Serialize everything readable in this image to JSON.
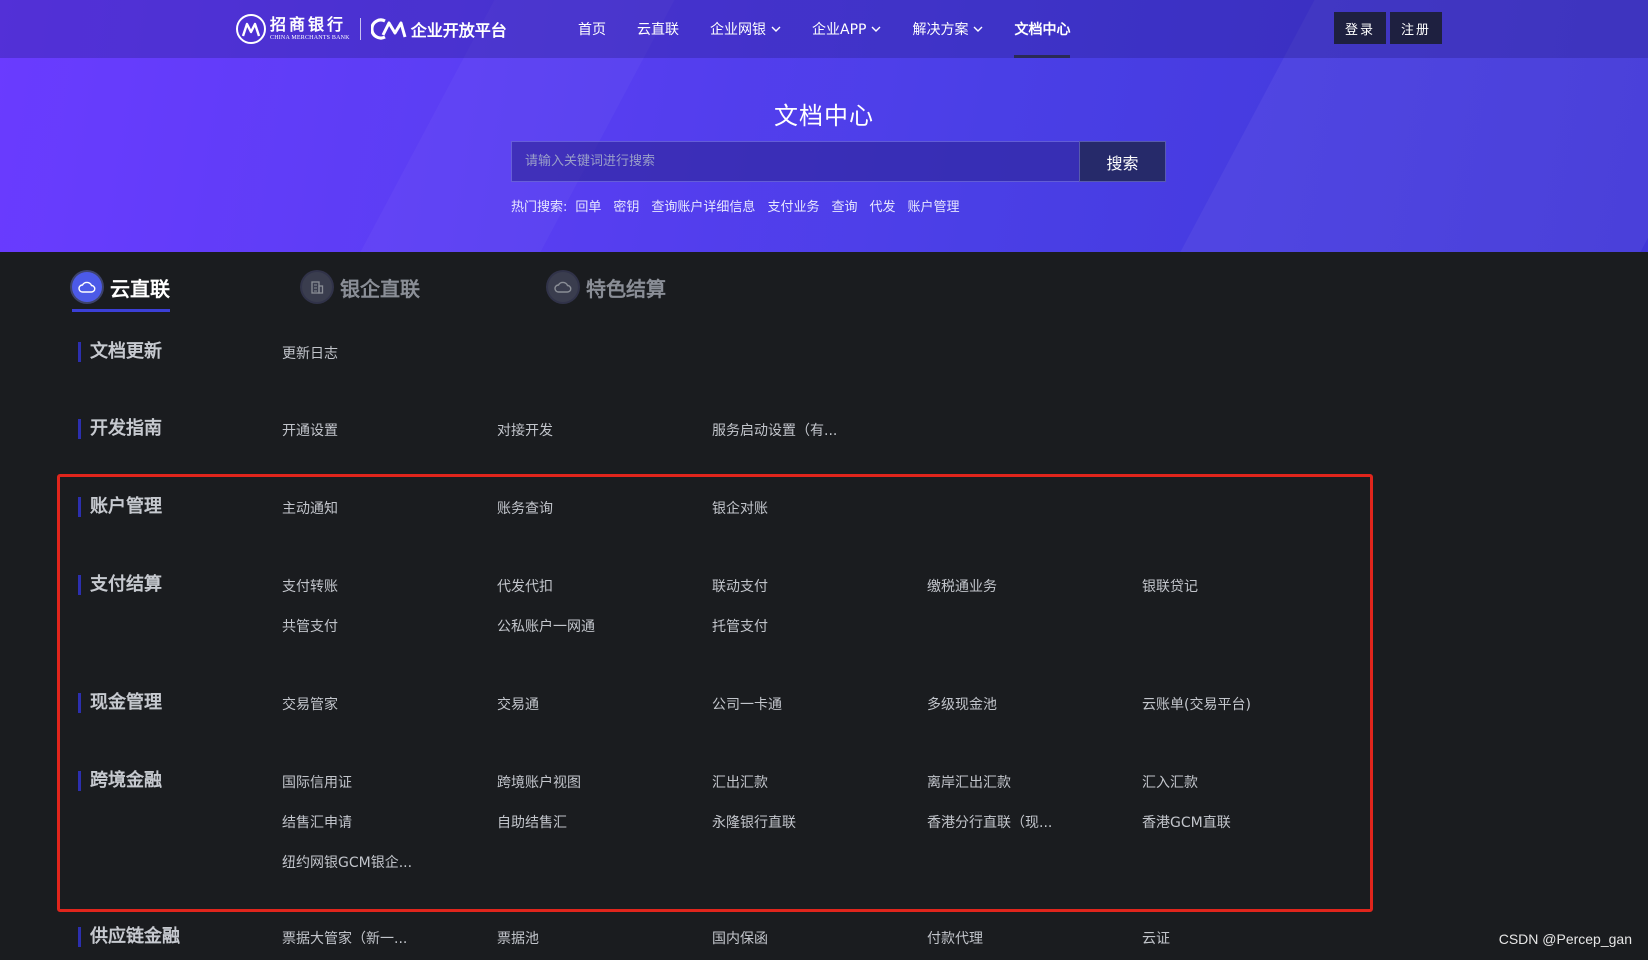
{
  "header": {
    "bank_name": "招商银行",
    "bank_name_en": "CHINA MERCHANTS BANK",
    "platform_name": "企业开放平台",
    "nav": [
      {
        "label": "首页",
        "dropdown": false
      },
      {
        "label": "云直联",
        "dropdown": false
      },
      {
        "label": "企业网银",
        "dropdown": true
      },
      {
        "label": "企业APP",
        "dropdown": true
      },
      {
        "label": "解决方案",
        "dropdown": true
      },
      {
        "label": "文档中心",
        "dropdown": false,
        "active": true
      }
    ],
    "login_label": "登录",
    "register_label": "注册"
  },
  "hero": {
    "title": "文档中心",
    "search_placeholder": "请输入关键词进行搜索",
    "search_button": "搜索",
    "hot_label": "热门搜索:",
    "hot_items": [
      "回单",
      "密钥",
      "查询账户详细信息",
      "支付业务",
      "查询",
      "代发",
      "账户管理"
    ]
  },
  "tabs": [
    {
      "label": "云直联",
      "icon": "cloud-icon",
      "active": true
    },
    {
      "label": "银企直联",
      "icon": "building-icon",
      "active": false
    },
    {
      "label": "特色结算",
      "icon": "cloud-icon",
      "active": false
    }
  ],
  "sections": [
    {
      "title": "文档更新",
      "items": [
        "更新日志"
      ]
    },
    {
      "title": "开发指南",
      "items": [
        "开通设置",
        "对接开发",
        "服务启动设置（有..."
      ]
    },
    {
      "title": "账户管理",
      "items": [
        "主动通知",
        "账务查询",
        "银企对账"
      ]
    },
    {
      "title": "支付结算",
      "items": [
        "支付转账",
        "代发代扣",
        "联动支付",
        "缴税通业务",
        "银联贷记",
        "共管支付",
        "公私账户一网通",
        "托管支付"
      ]
    },
    {
      "title": "现金管理",
      "items": [
        "交易管家",
        "交易通",
        "公司一卡通",
        "多级现金池",
        "云账单(交易平台)"
      ]
    },
    {
      "title": "跨境金融",
      "items": [
        "国际信用证",
        "跨境账户视图",
        "汇出汇款",
        "离岸汇出汇款",
        "汇入汇款",
        "结售汇申请",
        "自助结售汇",
        "永隆银行直联",
        "香港分行直联（现...",
        "香港GCM直联",
        "纽约网银GCM银企..."
      ]
    },
    {
      "title": "供应链金融",
      "items": [
        "票据大管家（新一...",
        "票据池",
        "国内保函",
        "付款代理",
        "云证"
      ]
    }
  ],
  "watermark": "CSDN @Percep_gan",
  "colors": {
    "accent": "#3b3fd6",
    "highlight_border": "#e0251c",
    "background": "#1a1c1f"
  }
}
